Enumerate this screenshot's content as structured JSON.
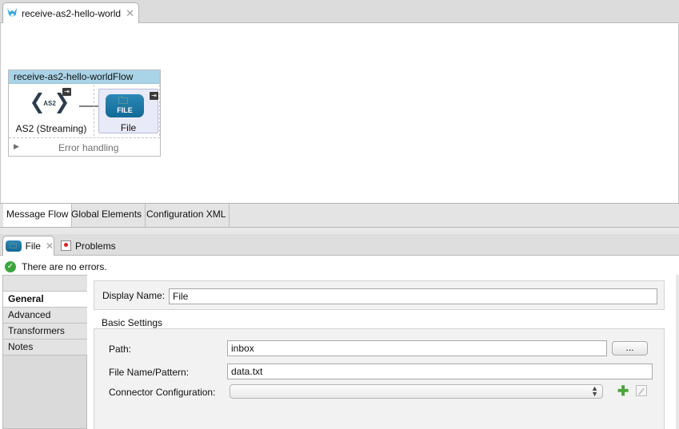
{
  "editor": {
    "tab_title": "receive-as2-hello-world",
    "flow": {
      "name": "receive-as2-hello-worldFlow",
      "source": {
        "label": "AS2 (Streaming)",
        "icon_text": "AS2"
      },
      "processor": {
        "label": "File",
        "icon_text": "FILE"
      },
      "error_handling": "Error handling"
    },
    "bottom_tabs": [
      "Message Flow",
      "Global Elements",
      "Configuration XML"
    ]
  },
  "properties": {
    "tabs": {
      "file": "File",
      "problems": "Problems"
    },
    "status": "There are no errors.",
    "nav": [
      "General",
      "Advanced",
      "Transformers",
      "Notes"
    ],
    "selected_nav": "General",
    "display_name": {
      "label": "Display Name:",
      "value": "File"
    },
    "basic_settings": {
      "title": "Basic Settings",
      "path": {
        "label": "Path:",
        "value": "inbox"
      },
      "browse_label": "...",
      "file_name": {
        "label": "File Name/Pattern:",
        "value": "data.txt"
      },
      "connector": {
        "label": "Connector Configuration:",
        "value": ""
      }
    }
  },
  "colors": {
    "flow_header": "#a9d3e6",
    "file_icon": "#1a78a8",
    "ok_icon": "#3ca63c",
    "add_icon": "#4aa53a"
  }
}
